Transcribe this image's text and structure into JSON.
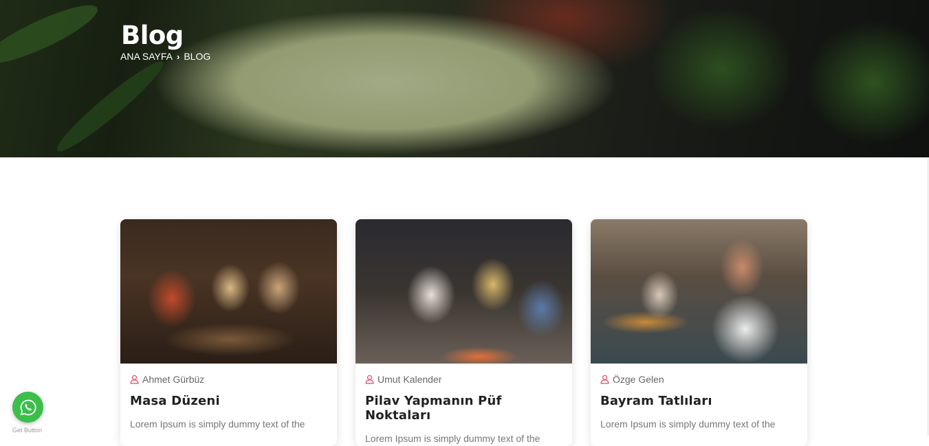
{
  "hero": {
    "title": "Blog",
    "breadcrumb": {
      "home": "ANA SAYFA",
      "separator": "›",
      "current": "BLOG"
    }
  },
  "posts": [
    {
      "author": "Ahmet Gürbüz",
      "title": "Masa Düzeni",
      "excerpt": "Lorem Ipsum is simply dummy text of the"
    },
    {
      "author": "Umut Kalender",
      "title": "Pilav Yapmanın Püf Noktaları",
      "excerpt": "Lorem Ipsum is simply dummy text of the"
    },
    {
      "author": "Özge Gelen",
      "title": "Bayram Tatlıları",
      "excerpt": "Lorem Ipsum is simply dummy text of the"
    }
  ],
  "whatsapp": {
    "label": "Get Button"
  },
  "colors": {
    "accent": "#e8445a",
    "whatsapp": "#3bbf4a",
    "text": "#222222",
    "muted": "#777777"
  }
}
